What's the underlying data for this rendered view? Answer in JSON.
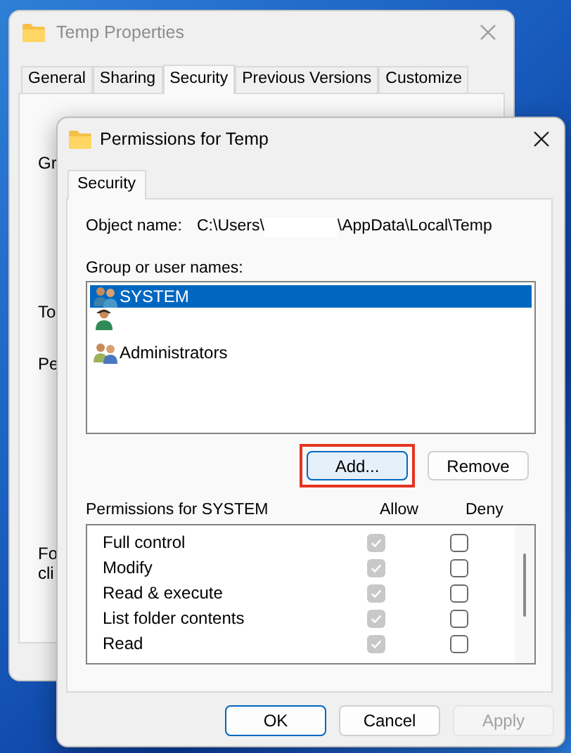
{
  "back_window": {
    "title": "Temp Properties",
    "tabs": [
      {
        "label": "General",
        "selected": false
      },
      {
        "label": "Sharing",
        "selected": false
      },
      {
        "label": "Security",
        "selected": true
      },
      {
        "label": "Previous Versions",
        "selected": false
      },
      {
        "label": "Customize",
        "selected": false
      }
    ],
    "fragments": [
      "Gr",
      "To",
      "Pe",
      "Fo",
      "cli"
    ]
  },
  "dialog": {
    "title": "Permissions for Temp",
    "tabs": [
      {
        "label": "Security",
        "selected": true
      }
    ],
    "object_label": "Object name:",
    "object_path_start": "C:\\Users\\",
    "object_path_end": "\\AppData\\Local\\Temp",
    "group_label": "Group or user names:",
    "users": [
      {
        "kind": "group",
        "name": "SYSTEM",
        "selected": true
      },
      {
        "kind": "user",
        "selected": false
      },
      {
        "kind": "admins",
        "name": "Administrators",
        "selected": false
      }
    ],
    "add_button": {
      "label": "Add...",
      "highlighted": true
    },
    "remove_button": {
      "label": "Remove"
    },
    "permissions_label": "Permissions for SYSTEM",
    "allow_header": "Allow",
    "deny_header": "Deny",
    "permissions": [
      {
        "name": "Full control",
        "allow": true,
        "deny": false
      },
      {
        "name": "Modify",
        "allow": true,
        "deny": false
      },
      {
        "name": "Read & execute",
        "allow": true,
        "deny": false
      },
      {
        "name": "List folder contents",
        "allow": true,
        "deny": false
      },
      {
        "name": "Read",
        "allow": true,
        "deny": false
      }
    ],
    "allow_disabled": true,
    "buttons": [
      {
        "label": "OK",
        "kind": "default",
        "disabled": false
      },
      {
        "label": "Cancel",
        "kind": "normal",
        "disabled": false
      },
      {
        "label": "Apply",
        "kind": "normal",
        "disabled": true
      }
    ]
  }
}
